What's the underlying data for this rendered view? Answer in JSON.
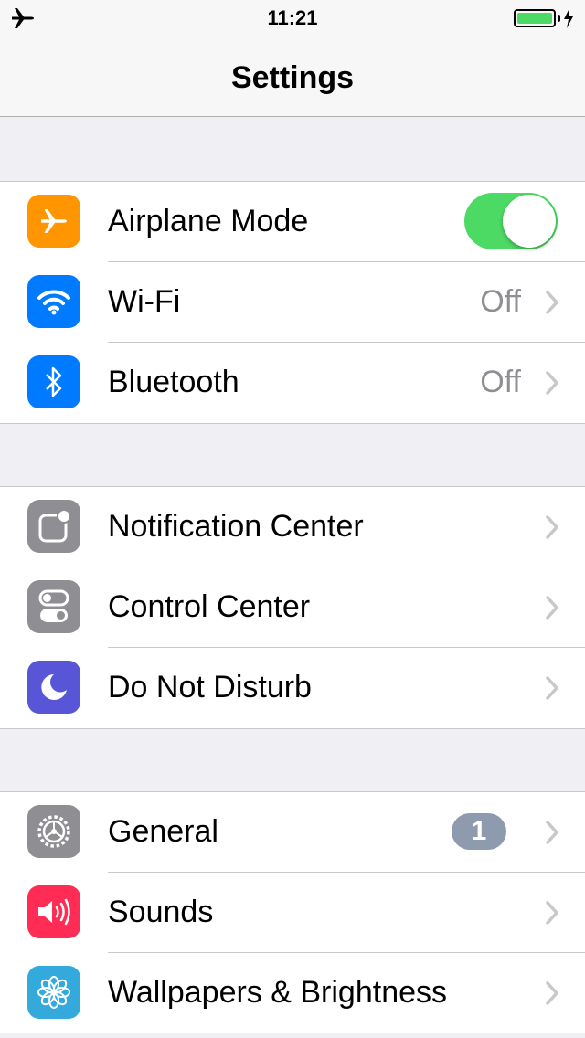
{
  "status_bar": {
    "time": "11:21",
    "left_icon": "airplane-icon",
    "battery_icon": "battery-full-icon",
    "charging_icon": "bolt-icon"
  },
  "nav": {
    "title": "Settings"
  },
  "colors": {
    "orange": "#ff9500",
    "blue": "#007aff",
    "gray": "#8e8e93",
    "purple": "#5856d6",
    "red": "#ff2d55",
    "teal": "#34aadc",
    "green": "#4cd964"
  },
  "groups": [
    {
      "rows": [
        {
          "label": "Airplane Mode",
          "icon": "airplane-icon",
          "toggle": true
        },
        {
          "label": "Wi-Fi",
          "icon": "wifi-icon",
          "value": "Off"
        },
        {
          "label": "Bluetooth",
          "icon": "bluetooth-icon",
          "value": "Off"
        }
      ]
    },
    {
      "rows": [
        {
          "label": "Notification Center",
          "icon": "notification-center-icon"
        },
        {
          "label": "Control Center",
          "icon": "control-center-icon"
        },
        {
          "label": "Do Not Disturb",
          "icon": "moon-icon"
        }
      ]
    },
    {
      "rows": [
        {
          "label": "General",
          "icon": "gear-icon",
          "badge": "1"
        },
        {
          "label": "Sounds",
          "icon": "speaker-icon"
        },
        {
          "label": "Wallpapers & Brightness",
          "icon": "flower-icon"
        }
      ]
    }
  ]
}
